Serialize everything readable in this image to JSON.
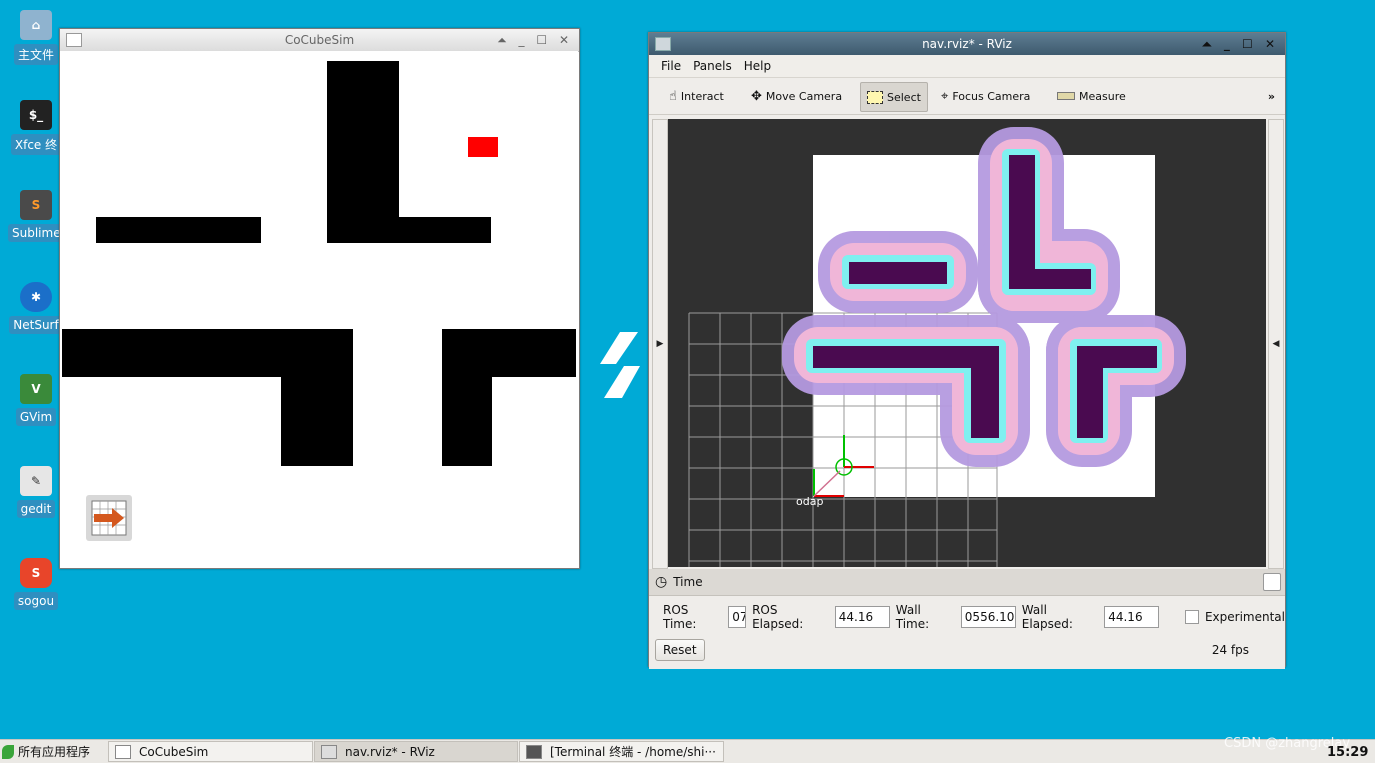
{
  "desktop": {
    "icons": [
      {
        "label": "主文件",
        "icon": "home-folder-icon"
      },
      {
        "label": "Xfce 终",
        "icon": "terminal-icon"
      },
      {
        "label": "Sublime",
        "icon": "sublime-icon"
      },
      {
        "label": "NetSurf",
        "icon": "netsurf-icon"
      },
      {
        "label": "GVim",
        "icon": "gvim-icon"
      },
      {
        "label": "gedit",
        "icon": "gedit-icon"
      },
      {
        "label": "sogou",
        "icon": "sogou-icon"
      }
    ]
  },
  "sim_window": {
    "title": "CoCubeSim",
    "controls": "⏶ _ ☐ ✕"
  },
  "rviz_window": {
    "title": "nav.rviz* - RViz",
    "controls": "⏶ _ ☐ ✕",
    "menu": [
      "File",
      "Panels",
      "Help"
    ],
    "tools": [
      "Interact",
      "Move Camera",
      "Select",
      "Focus Camera",
      "Measure"
    ],
    "more": "»",
    "frame_label": "odap",
    "time_panel": {
      "title": "Time",
      "ros_time_label": "ROS Time:",
      "ros_time_value": "07",
      "ros_elapsed_label": "ROS Elapsed:",
      "ros_elapsed_value": "44.16",
      "wall_time_label": "Wall Time:",
      "wall_time_value": "0556.10",
      "wall_elapsed_label": "Wall Elapsed:",
      "wall_elapsed_value": "44.16",
      "experimental_label": "Experimental",
      "reset_label": "Reset",
      "fps": "24 fps"
    }
  },
  "taskbar": {
    "start_label": "所有应用程序",
    "tasks": [
      "CoCubeSim",
      "nav.rviz* - RViz",
      "[Terminal 终端 - /home/shi···"
    ],
    "clock": "15:29",
    "watermark": "CSDN @zhangrelay"
  },
  "colors": {
    "desktop": "#00aad6",
    "obstacle": "#000000",
    "robot": "#ff0000",
    "costmap_lethal": "#4a0a50",
    "costmap_inscribed": "#7ff0f0"
  }
}
